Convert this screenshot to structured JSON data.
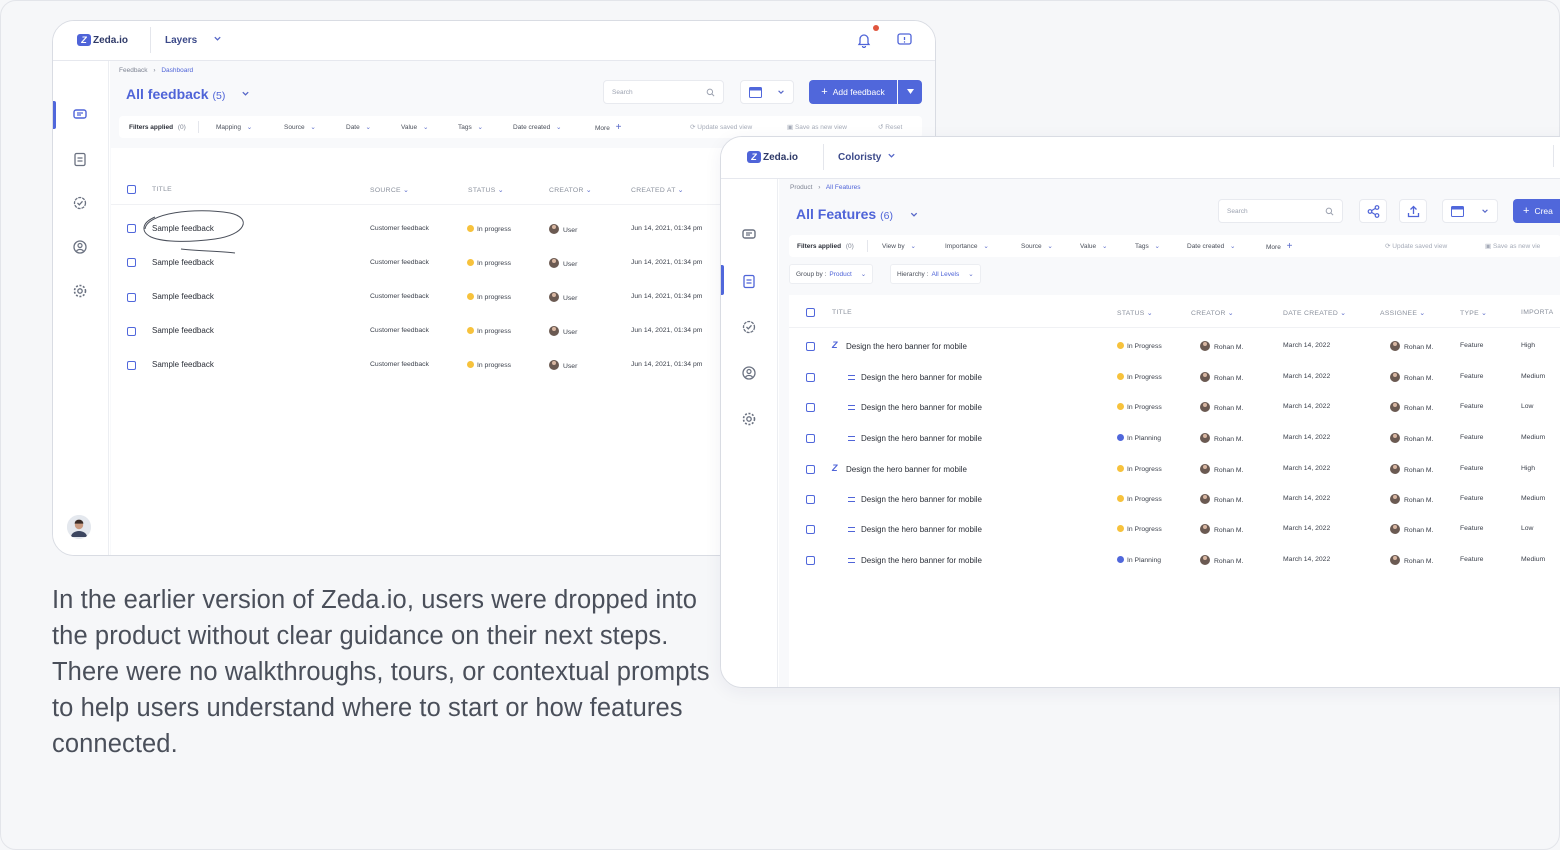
{
  "caption": "In the earlier version of Zeda.io, users were dropped into the product without clear guidance on their next steps. There were no walkthroughs, tours, or contextual prompts to help users understand where to start or how features connected.",
  "colors": {
    "accent": "#5067db",
    "in_progress": "#f7c23c",
    "in_planning": "#5067db"
  },
  "win1": {
    "logo": "Zeda.io",
    "workspace": "Layers",
    "breadcrumb": [
      "Feedback",
      "Dashboard"
    ],
    "title": "All feedback",
    "count": "(5)",
    "search_placeholder": "Search",
    "add_button": "Add feedback",
    "filters": {
      "applied_label": "Filters applied",
      "applied_count": "(0)",
      "items": [
        "Mapping",
        "Source",
        "Date",
        "Value",
        "Tags",
        "Date created",
        "More"
      ],
      "update_saved_view": "Update saved view",
      "save_as_new_view": "Save as new view",
      "reset": "Reset"
    },
    "columns": [
      "TITLE",
      "SOURCE",
      "STATUS",
      "CREATOR",
      "CREATED AT"
    ],
    "rows": [
      {
        "title": "Sample feedback",
        "source": "Customer feedback",
        "status": "In progress",
        "creator": "User",
        "created_at": "Jun 14, 2021, 01:34 pm"
      },
      {
        "title": "Sample feedback",
        "source": "Customer feedback",
        "status": "In progress",
        "creator": "User",
        "created_at": "Jun 14, 2021, 01:34 pm"
      },
      {
        "title": "Sample feedback",
        "source": "Customer feedback",
        "status": "In progress",
        "creator": "User",
        "created_at": "Jun 14, 2021, 01:34 pm"
      },
      {
        "title": "Sample feedback",
        "source": "Customer feedback",
        "status": "In progress",
        "creator": "User",
        "created_at": "Jun 14, 2021, 01:34 pm"
      },
      {
        "title": "Sample feedback",
        "source": "Customer feedback",
        "status": "In progress",
        "creator": "User",
        "created_at": "Jun 14, 2021, 01:34 pm"
      }
    ]
  },
  "win2": {
    "logo": "Zeda.io",
    "workspace": "Coloristy",
    "breadcrumb": [
      "Product",
      "All Features"
    ],
    "title": "All Features",
    "count": "(6)",
    "search_placeholder": "Search",
    "create_button": "Crea",
    "filters": {
      "applied_label": "Filters applied",
      "applied_count": "(0)",
      "items": [
        "View by",
        "Importance",
        "Source",
        "Value",
        "Tags",
        "Date created",
        "More"
      ],
      "update_saved_view": "Update saved view",
      "save_as_new_view": "Save as new vie"
    },
    "group_by": {
      "label": "Group by :",
      "value": "Product"
    },
    "hierarchy": {
      "label": "Hierarchy :",
      "value": "All Levels"
    },
    "columns": [
      "TITLE",
      "STATUS",
      "CREATOR",
      "DATE CREATED",
      "ASSIGNEE",
      "TYPE",
      "IMPORTA"
    ],
    "rows": [
      {
        "level": 0,
        "title": "Design the hero banner for mobile",
        "status": "In Progress",
        "creator": "Rohan M.",
        "date": "March 14, 2022",
        "assignee": "Rohan M.",
        "type": "Feature",
        "importance": "High"
      },
      {
        "level": 1,
        "title": "Design the hero banner for mobile",
        "status": "In Progress",
        "creator": "Rohan M.",
        "date": "March 14, 2022",
        "assignee": "Rohan M.",
        "type": "Feature",
        "importance": "Medium"
      },
      {
        "level": 1,
        "title": "Design the hero banner for mobile",
        "status": "In Progress",
        "creator": "Rohan M.",
        "date": "March 14, 2022",
        "assignee": "Rohan M.",
        "type": "Feature",
        "importance": "Low"
      },
      {
        "level": 1,
        "title": "Design the hero banner for mobile",
        "status": "In Planning",
        "creator": "Rohan M.",
        "date": "March 14, 2022",
        "assignee": "Rohan M.",
        "type": "Feature",
        "importance": "Medium"
      },
      {
        "level": 0,
        "title": "Design the hero banner for mobile",
        "status": "In Progress",
        "creator": "Rohan M.",
        "date": "March 14, 2022",
        "assignee": "Rohan M.",
        "type": "Feature",
        "importance": "High"
      },
      {
        "level": 1,
        "title": "Design the hero banner for mobile",
        "status": "In Progress",
        "creator": "Rohan M.",
        "date": "March 14, 2022",
        "assignee": "Rohan M.",
        "type": "Feature",
        "importance": "Medium"
      },
      {
        "level": 1,
        "title": "Design the hero banner for mobile",
        "status": "In Progress",
        "creator": "Rohan M.",
        "date": "March 14, 2022",
        "assignee": "Rohan M.",
        "type": "Feature",
        "importance": "Low"
      },
      {
        "level": 1,
        "title": "Design the hero banner for mobile",
        "status": "In Planning",
        "creator": "Rohan M.",
        "date": "March 14, 2022",
        "assignee": "Rohan M.",
        "type": "Feature",
        "importance": "Medium"
      }
    ]
  }
}
